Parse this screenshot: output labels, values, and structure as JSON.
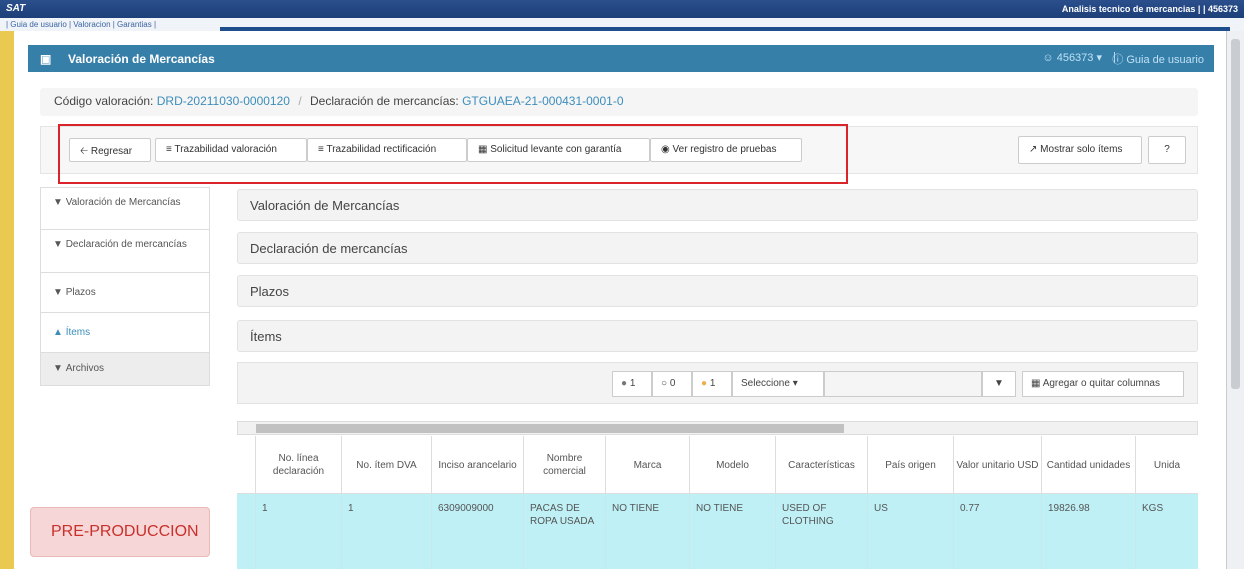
{
  "topbar": {
    "logo": "SAT",
    "title": "Analisis tecnico de mercancias | | 456373"
  },
  "links": {
    "text": "| Guia de usuario | Valoracion | Garantias |"
  },
  "panel": {
    "title": "Valoración de Mercancías",
    "user": "456373 ▾",
    "separator": "|",
    "guide": "Guia de usuario"
  },
  "breadcrumb": {
    "code_label": "Código valoración:",
    "code_value": "DRD-20211030-0000120",
    "sep": "/",
    "decl_label": "Declaración de mercancías:",
    "decl_value": "GTGUAEA-21-000431-0001-0"
  },
  "toolbar": {
    "back": "Regresar",
    "trace_valuation": "Trazabilidad valoración",
    "trace_rect": "Trazabilidad rectificación",
    "guarantee": "Solicitud levante con garantía",
    "tests": "Ver registro de pruebas",
    "show_items": "Mostrar solo ítems",
    "help": "?"
  },
  "sidebar": {
    "items": [
      {
        "label": "Valoración de Mercancías",
        "icon": "caret-down"
      },
      {
        "label": "Declaración de mercancías",
        "icon": "caret-down"
      },
      {
        "label": "Plazos",
        "icon": "caret-down"
      },
      {
        "label": "Ítems",
        "icon": "caret-up"
      },
      {
        "label": "Archivos",
        "icon": "caret-down"
      }
    ]
  },
  "sections": [
    "Valoración de Mercancías",
    "Declaración de mercancías",
    "Plazos",
    "Ítems"
  ],
  "filters": {
    "count_filled": "1",
    "count_empty": "0",
    "count_orange": "1",
    "select_label": "Seleccione",
    "columns_label": "Agregar o quitar columnas"
  },
  "table": {
    "headers": [
      "No. línea declaración",
      "No. ítem DVA",
      "Inciso arancelario",
      "Nombre comercial",
      "Marca",
      "Modelo",
      "Características",
      "País origen",
      "Valor unitario USD",
      "Cantidad unidades",
      "Unida"
    ],
    "row": [
      "1",
      "1",
      "6309009000",
      "PACAS DE ROPA USADA",
      "NO TIENE",
      "NO TIENE",
      "USED OF CLOTHING",
      "US",
      "0.77",
      "19826.98",
      "KGS"
    ]
  },
  "badge": {
    "text": "PRE-PRODUCCION"
  },
  "colors": {
    "header": "#367fa9",
    "accent_link": "#3c8dbc",
    "row_highlight": "#bff0f5",
    "red_outline": "#d9242b"
  }
}
